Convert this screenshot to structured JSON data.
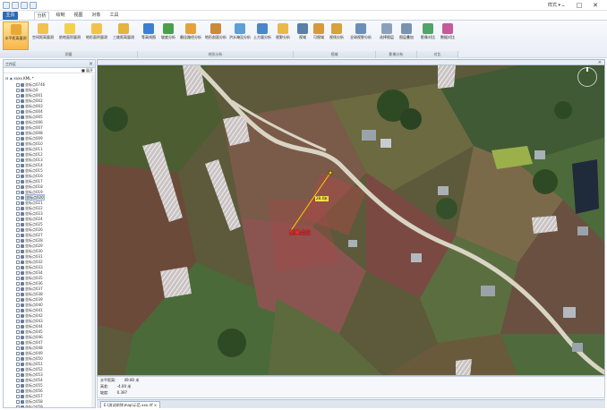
{
  "window": {
    "title": "",
    "style_menu": "样式 ▾",
    "buttons": [
      "–",
      "□",
      "✕"
    ]
  },
  "tabs": [
    {
      "label": "主页",
      "active": false,
      "file": true
    },
    {
      "label": "分析",
      "active": true
    },
    {
      "label": "绘制",
      "active": false
    },
    {
      "label": "视图",
      "active": false
    },
    {
      "label": "对象",
      "active": false
    },
    {
      "label": "工具",
      "active": false
    }
  ],
  "ribbon": {
    "buttons": [
      {
        "label": "水平距离量测",
        "icon": "horizontal-distance-icon",
        "color": "#e8a93a",
        "active": true
      },
      {
        "label": "空间距离量测",
        "icon": "space-distance-icon",
        "color": "#f2c14e"
      },
      {
        "label": "依地面积量测",
        "icon": "ground-area-icon",
        "color": "#f4d14a"
      },
      {
        "label": "地形面积量测",
        "icon": "terrain-area-icon",
        "color": "#f1c24d"
      },
      {
        "label": "三维距离量测",
        "icon": "3d-distance-icon",
        "color": "#e3b53d"
      },
      {
        "label": "等高线图",
        "icon": "contour-icon",
        "color": "#3a7fd0"
      },
      {
        "label": "坡度分析",
        "icon": "slope-icon",
        "color": "#4aa04a"
      },
      {
        "label": "最佳路径分析",
        "icon": "best-path-icon",
        "color": "#e6a23a"
      },
      {
        "label": "地形剖面分析",
        "icon": "terrain-profile-icon",
        "color": "#c98a3a"
      },
      {
        "label": "洪水淹没分析",
        "icon": "flood-icon",
        "color": "#5f9fd6"
      },
      {
        "label": "土方量分析",
        "icon": "earthwork-icon",
        "color": "#4a86c8"
      },
      {
        "label": "视野分析",
        "icon": "viewshed-icon",
        "color": "#e8b94a"
      },
      {
        "label": "视域",
        "icon": "view-area-icon",
        "color": "#5a7fa8"
      },
      {
        "label": "可视域",
        "icon": "visible-area-icon",
        "color": "#d69a3a"
      },
      {
        "label": "视线分析",
        "icon": "line-of-sight-icon",
        "color": "#d6a23a"
      },
      {
        "label": "全球视野分析",
        "icon": "global-view-icon",
        "color": "#6b8fb8"
      },
      {
        "label": "选择图层",
        "icon": "select-layer-icon",
        "color": "#8aa1be"
      },
      {
        "label": "图层叠加",
        "icon": "layer-overlay-icon",
        "color": "#7a92b2"
      },
      {
        "label": "影像对比",
        "icon": "image-compare-icon",
        "color": "#52a36a"
      },
      {
        "label": "数据对比",
        "icon": "data-compare-icon",
        "color": "#c45a9a"
      }
    ],
    "groups": [
      {
        "label": "测量"
      },
      {
        "label": "地形分析"
      },
      {
        "label": "视域"
      },
      {
        "label": "影像分析"
      },
      {
        "label": "对比"
      }
    ]
  },
  "panel": {
    "title": "工作区",
    "close": "×",
    "tool_label": "■ 展开",
    "root_label": "xxxx.KML *",
    "items": [
      "坐标点0746",
      "坐标点0",
      "坐标点001",
      "坐标点002",
      "坐标点003",
      "坐标点004",
      "坐标点005",
      "坐标点006",
      "坐标点007",
      "坐标点008",
      "坐标点009",
      "坐标点010",
      "坐标点011",
      "坐标点012",
      "坐标点013",
      "坐标点014",
      "坐标点015",
      "坐标点016",
      "坐标点017",
      "坐标点018",
      "坐标点019",
      "坐标点020",
      "坐标点021",
      "坐标点022",
      "坐标点023",
      "坐标点024",
      "坐标点025",
      "坐标点026",
      "坐标点027",
      "坐标点028",
      "坐标点029",
      "坐标点030",
      "坐标点031",
      "坐标点032",
      "坐标点033",
      "坐标点034",
      "坐标点035",
      "坐标点036",
      "坐标点037",
      "坐标点038",
      "坐标点039",
      "坐标点040",
      "坐标点041",
      "坐标点042",
      "坐标点043",
      "坐标点044",
      "坐标点045",
      "坐标点046",
      "坐标点047",
      "坐标点048",
      "坐标点049",
      "坐标点050",
      "坐标点051",
      "坐标点052",
      "坐标点053",
      "坐标点054",
      "坐标点055",
      "坐标点056",
      "坐标点057",
      "坐标点058",
      "坐标点059"
    ],
    "selected_index": 21
  },
  "map": {
    "close": "×",
    "point_label": "测量点位",
    "distance_label": "28.4米",
    "colors": {
      "measure_line": "#ffcc00",
      "label": "#ff2a2a",
      "road": "#d9d4c4"
    }
  },
  "status": {
    "rows": [
      {
        "key": "水平距离:",
        "value": "49.80 米"
      },
      {
        "key": "高差:",
        "value": "-4.00 米"
      },
      {
        "key": "坡度:",
        "value": "0.397"
      }
    ]
  },
  "doc_tab": {
    "label": "E:\\测试样例\\map\\示范.xxx.rlf ×"
  }
}
